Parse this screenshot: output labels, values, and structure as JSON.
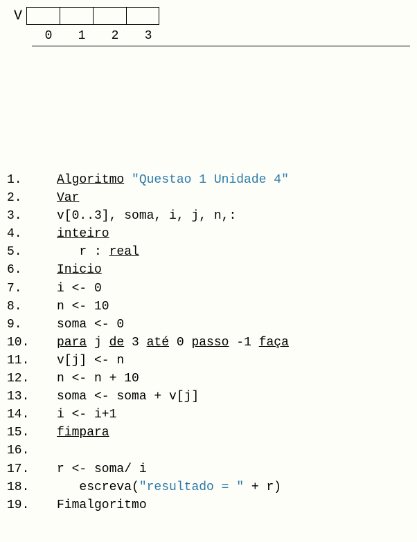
{
  "array": {
    "label": "V",
    "cells": [
      "",
      "",
      "",
      ""
    ],
    "indices": [
      "0",
      "1",
      "2",
      "3"
    ]
  },
  "lines": {
    "l1": {
      "num": "1.",
      "kw": "Algoritmo",
      "str": "\"Questao 1 Unidade 4\""
    },
    "l2": {
      "num": "2.",
      "kw": "Var"
    },
    "l3": {
      "num": "3.",
      "txt": "v[0..3], soma, i, j, n,:"
    },
    "l4": {
      "num": "4.",
      "kw": "inteiro"
    },
    "l5": {
      "num": "5.",
      "pre": "   r : ",
      "kw": "real"
    },
    "l6": {
      "num": "6.",
      "kw": "Inicio"
    },
    "l7": {
      "num": "7.",
      "txt": "i <- 0"
    },
    "l8": {
      "num": "8.",
      "txt": "n <- 10"
    },
    "l9": {
      "num": "9.",
      "txt": "soma <- 0"
    },
    "l10": {
      "num": "10.",
      "k1": "para",
      "t1": " j ",
      "k2": "de",
      "t2": " 3 ",
      "k3": "até",
      "t3": " 0 ",
      "k4": "passo",
      "t4": " -1 ",
      "k5": "faça"
    },
    "l11": {
      "num": "11.",
      "txt": "v[j] <- n"
    },
    "l12": {
      "num": "12.",
      "txt": "n <- n + 10"
    },
    "l13": {
      "num": "13.",
      "txt": "soma <- soma + v[j]"
    },
    "l14": {
      "num": "14.",
      "txt": "i <- i+1"
    },
    "l15": {
      "num": "15.",
      "kw": "fimpara"
    },
    "l16": {
      "num": "16.",
      "txt": ""
    },
    "l17": {
      "num": "17.",
      "txt": "r <- soma/ i"
    },
    "l18": {
      "num": "18.",
      "pre": "   escreva(",
      "str": "\"resultado = \"",
      "post": " + r)"
    },
    "l19": {
      "num": "19.",
      "txt": "Fimalgoritmo"
    }
  }
}
